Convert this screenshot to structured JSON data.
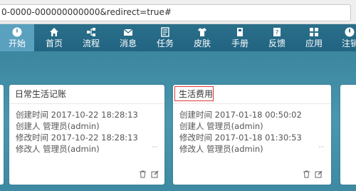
{
  "browser": {
    "url": "0-0000-000000000000&redirect=true#"
  },
  "nav": {
    "items": [
      {
        "label": "开始",
        "icon": "power-icon",
        "active": true
      },
      {
        "label": "首页",
        "icon": "home-icon"
      },
      {
        "label": "流程",
        "icon": "flow-icon"
      },
      {
        "label": "消息",
        "icon": "mail-icon"
      },
      {
        "label": "任务",
        "icon": "task-icon"
      },
      {
        "label": "皮肤",
        "icon": "shirt-icon"
      },
      {
        "label": "手册",
        "icon": "book-icon"
      },
      {
        "label": "反馈",
        "icon": "feedback-icon"
      },
      {
        "label": "应用",
        "icon": "apps-icon"
      },
      {
        "label": "注销",
        "icon": "logout-icon"
      }
    ]
  },
  "cards": [
    {
      "title": "日常生活记账",
      "created": "创建时间 2017-10-22 18:28:13",
      "creator": "创建人 管理员(admin)",
      "modified": "修改时间 2017-10-22 18:28:13",
      "modifier": "修改人 管理员(admin)",
      "more": "···"
    },
    {
      "title": "生活费用",
      "created": "创建时间 2017-01-18 00:50:02",
      "creator": "创建人 管理员(admin)",
      "modified": "修改时间 2017-01-18 01:30:53",
      "modifier": "修改人 管理员(admin)",
      "more": "···",
      "highlighted": true
    }
  ],
  "colors": {
    "nav_bg": "#216482",
    "active_tab": "#5aa0bf",
    "content_bg": "#3e8da6",
    "highlight": "#e03a3a"
  }
}
